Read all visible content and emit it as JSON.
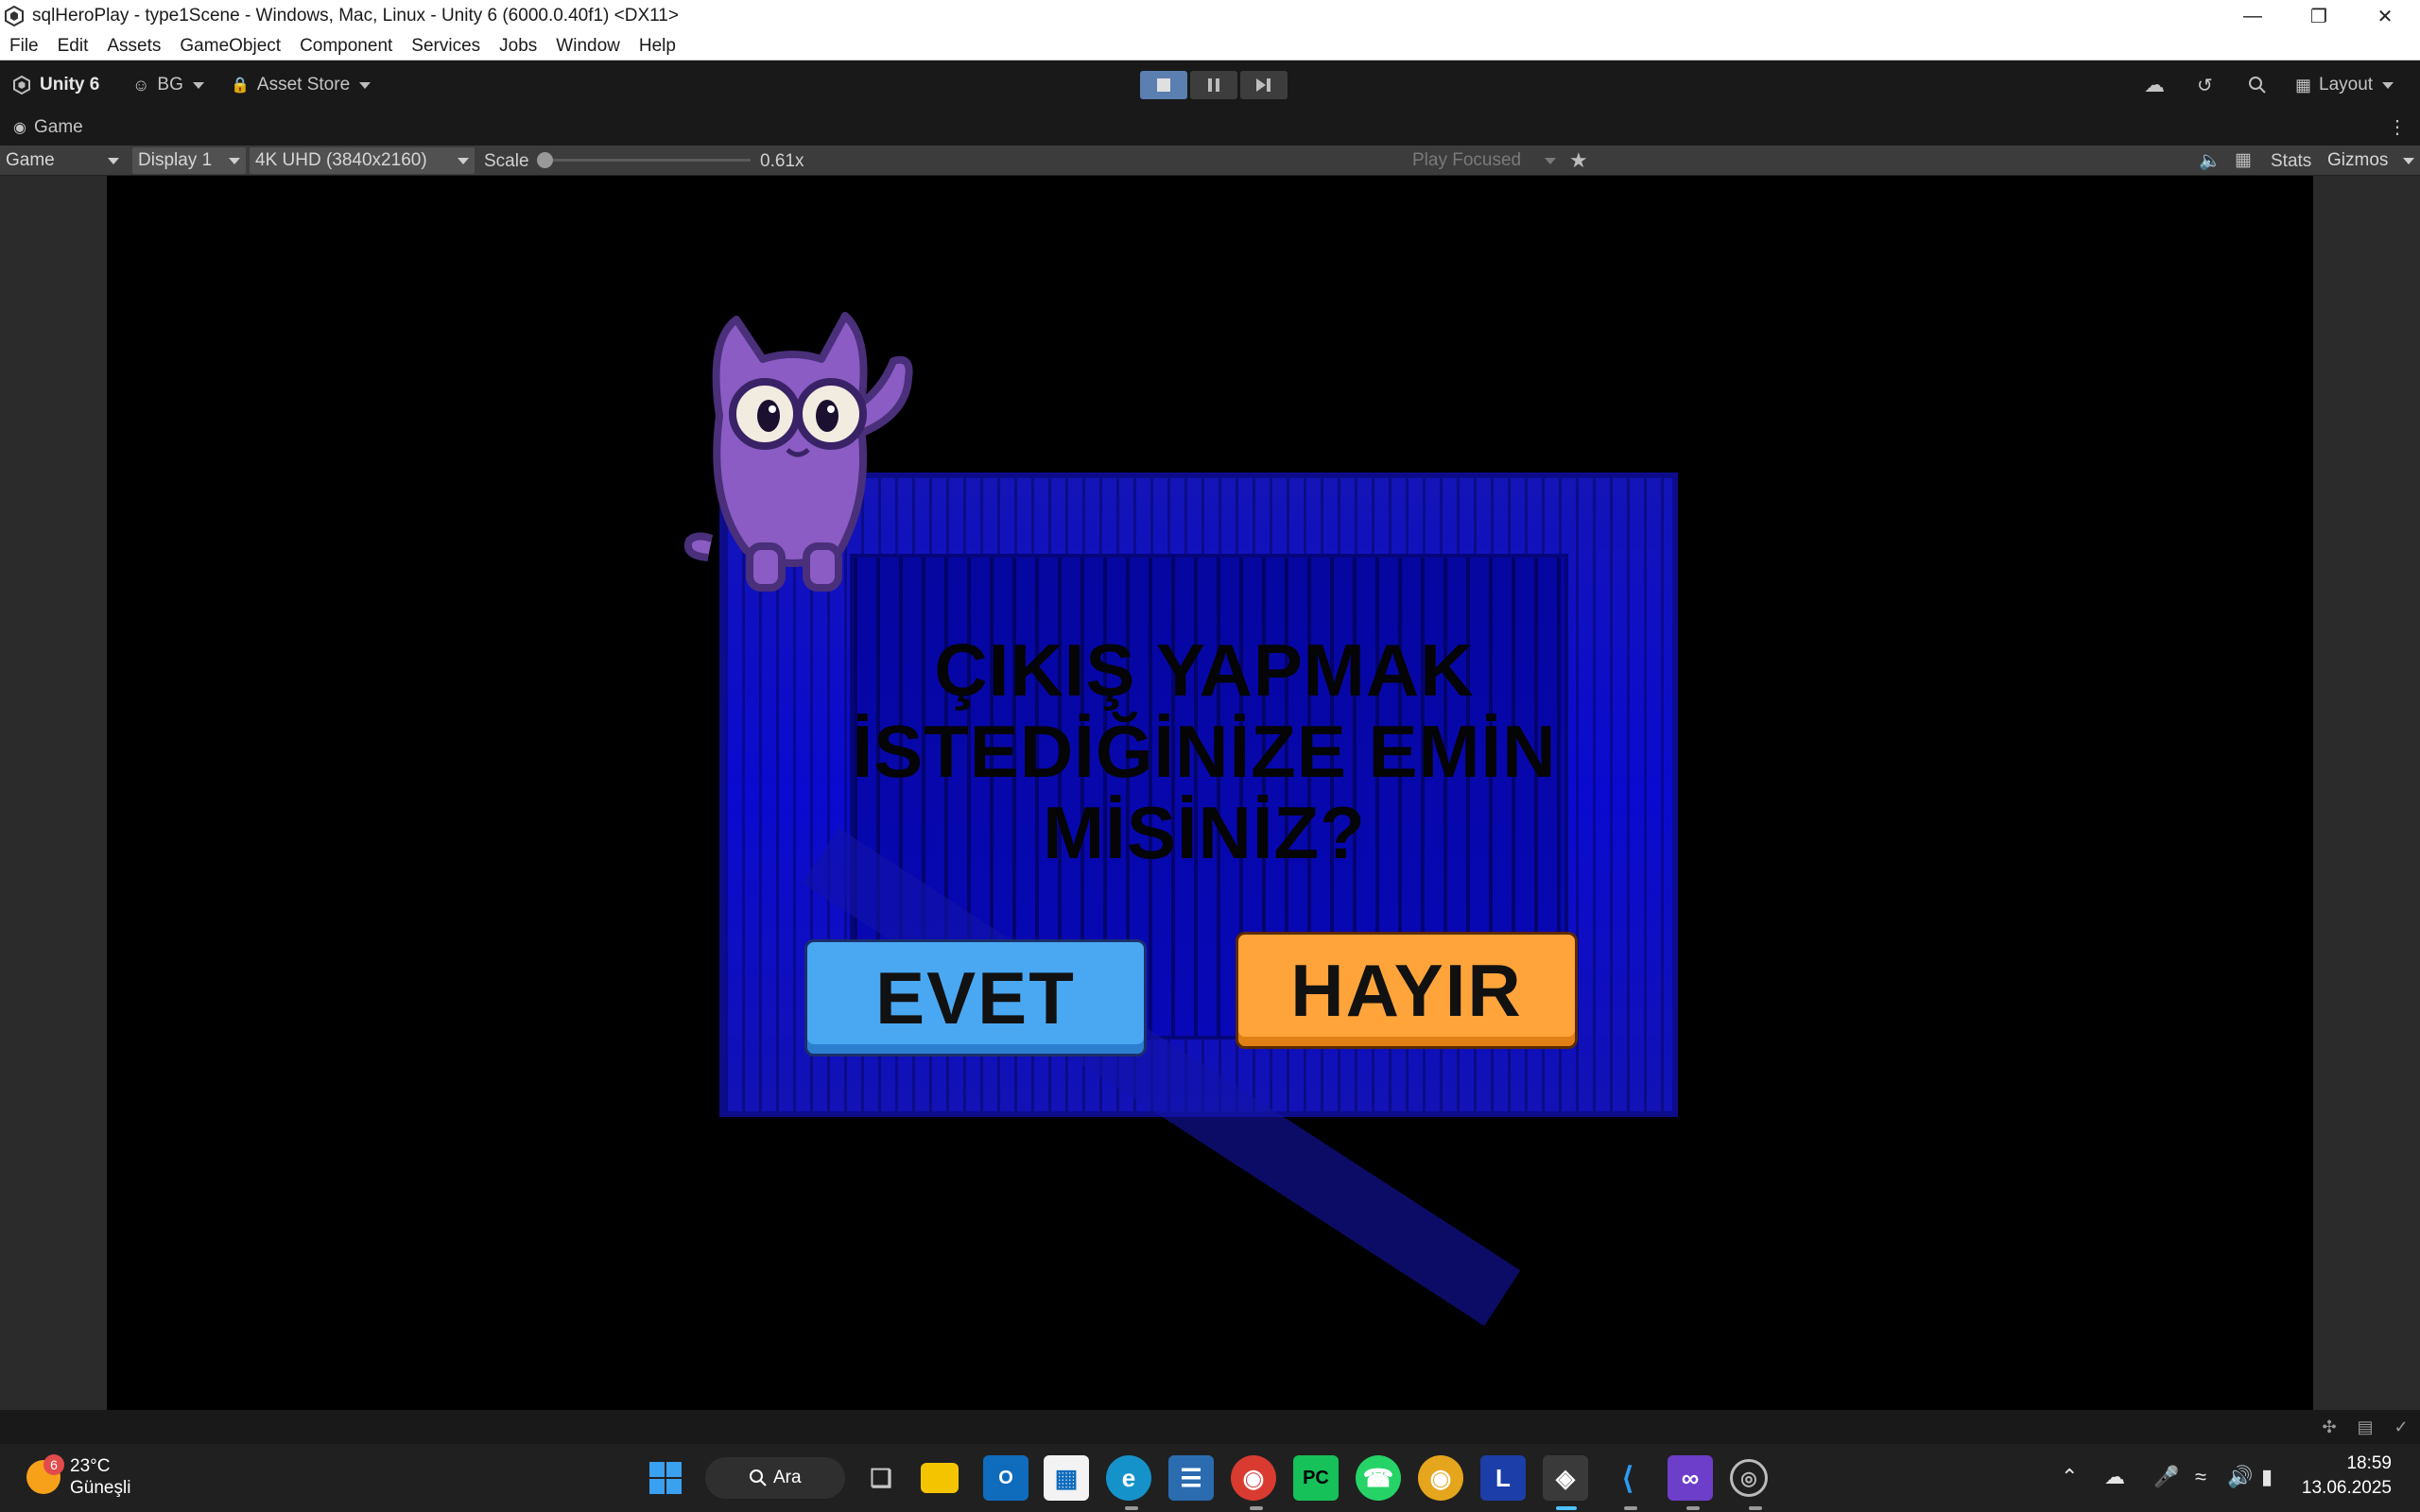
{
  "window": {
    "title": "sqlHeroPlay - type1Scene - Windows, Mac, Linux - Unity 6 (6000.0.40f1) <DX11>"
  },
  "menu": [
    "File",
    "Edit",
    "Assets",
    "GameObject",
    "Component",
    "Services",
    "Jobs",
    "Window",
    "Help"
  ],
  "toolbar": {
    "unity_label": "Unity 6",
    "account_label": "BG",
    "asset_store_label": "Asset Store",
    "layout_label": "Layout"
  },
  "game_tab": {
    "label": "Game"
  },
  "game_view": {
    "view_mode": "Game",
    "display": "Display 1",
    "resolution": "4K UHD (3840x2160)",
    "scale_label": "Scale",
    "scale_value": "0.61x",
    "scale_fraction": 0.0,
    "play_mode": "Play Focused",
    "stats_label": "Stats",
    "gizmos_label": "Gizmos"
  },
  "scene": {
    "dialog_lines": [
      "ÇIKIŞ YAPMAK",
      "İSTEDİĞİNİZE EMİN",
      "MİSİNİZ?"
    ],
    "yes_label": "EVET",
    "no_label": "HAYIR",
    "colors": {
      "crate": "#0a0ad0",
      "yes": "#4aa8f2",
      "no": "#ffa43a",
      "mascot": "#8a5cc4"
    }
  },
  "taskbar": {
    "weather_temp": "23°C",
    "weather_desc": "Güneşli",
    "weather_badge": "6",
    "search_label": "Ara",
    "time": "18:59",
    "date": "13.06.2025"
  }
}
